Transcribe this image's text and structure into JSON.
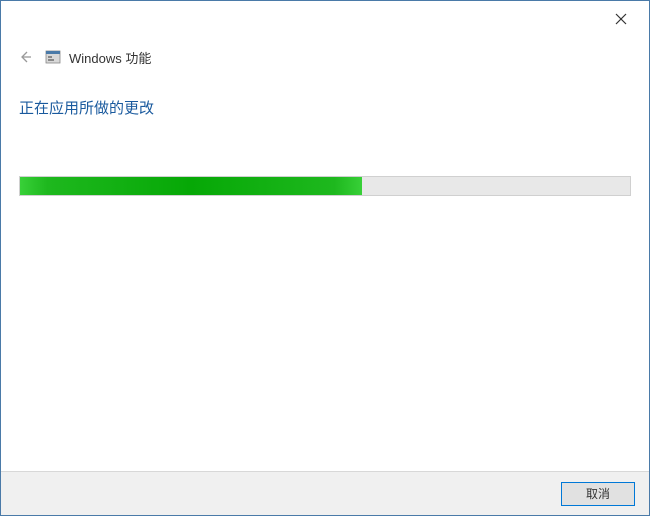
{
  "titlebar": {
    "close_icon": "close"
  },
  "header": {
    "back_icon": "back-arrow",
    "app_icon": "windows-features-icon",
    "title": "Windows 功能"
  },
  "content": {
    "status_text": "正在应用所做的更改",
    "progress_percent": 56
  },
  "footer": {
    "cancel_label": "取消"
  }
}
